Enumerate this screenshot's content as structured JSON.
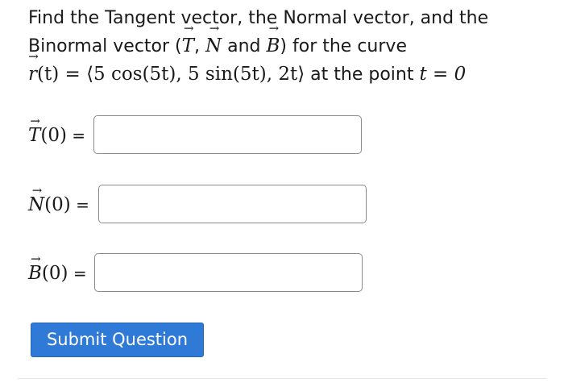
{
  "question": {
    "line1": "Find the Tangent vector, the Normal vector, and the",
    "line2_prefix": "Binormal vector (",
    "T": "T",
    "comma": ", ",
    "N": "N",
    "and": " and ",
    "B": "B",
    "line2_suffix": ") for the curve",
    "r_letter": "r",
    "curve_expression": "(t) = ⟨5 cos(5t), 5 sin(5t), 2t⟩",
    "at_the_point": " at the point ",
    "point": "t = 0"
  },
  "answers": [
    {
      "vector_letter": "T",
      "arg": "(0)",
      "equals": " =",
      "value": ""
    },
    {
      "vector_letter": "N",
      "arg": "(0)",
      "equals": " =",
      "value": ""
    },
    {
      "vector_letter": "B",
      "arg": "(0)",
      "equals": " =",
      "value": ""
    }
  ],
  "submit_label": "Submit Question",
  "colors": {
    "submit_background": "#2f7ad6",
    "input_border": "#8a8a8a"
  }
}
